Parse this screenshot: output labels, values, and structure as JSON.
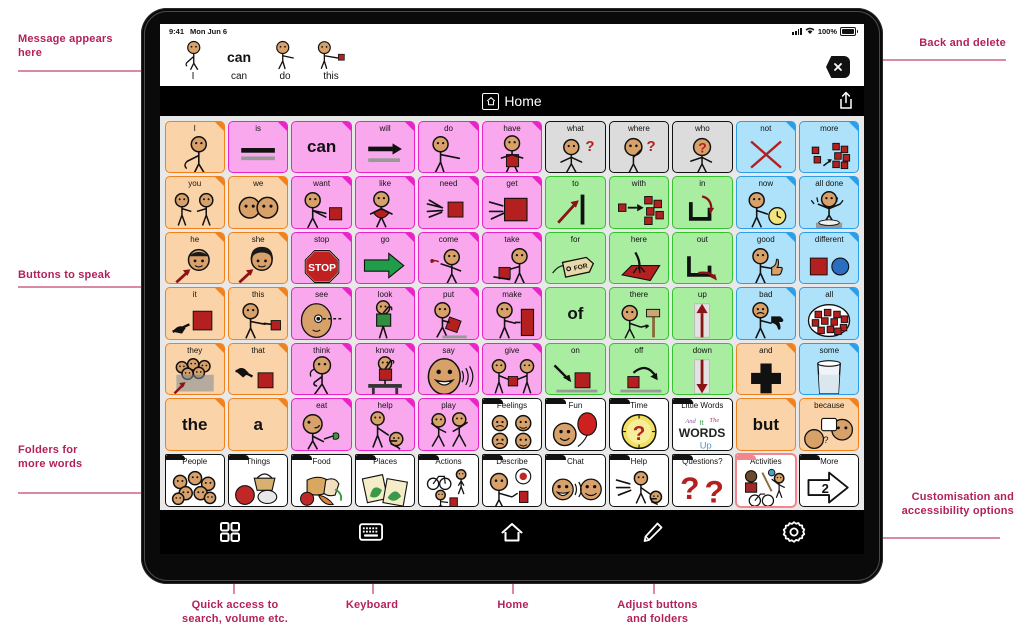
{
  "annotations": {
    "message_appears": "Message appears\nhere",
    "back_delete": "Back and delete",
    "buttons_to_speak": "Buttons to speak",
    "folders_more_words": "Folders for\nmore words",
    "customisation": "Customisation and\naccessibility options",
    "quick_access": "Quick access to\nsearch, volume etc.",
    "keyboard": "Keyboard",
    "home": "Home",
    "adjust": "Adjust buttons\nand folders",
    "color": "#b4215a"
  },
  "status_bar": {
    "time": "9:41",
    "date": "Mon Jun 6",
    "battery": "100%"
  },
  "message_bar": {
    "words": [
      {
        "label": "I",
        "type": "symbol",
        "symbol": "person-pointing-self"
      },
      {
        "label": "can",
        "type": "text",
        "big": "can"
      },
      {
        "label": "do",
        "type": "symbol",
        "symbol": "person-doing"
      },
      {
        "label": "this",
        "type": "symbol",
        "symbol": "person-pointing-block"
      }
    ],
    "clear_button": "clear-x-icon"
  },
  "nav_bar": {
    "title": "Home",
    "home_icon": "home-icon",
    "share_icon": "share-icon"
  },
  "toolbar": {
    "items": [
      {
        "name": "quick-access",
        "icon": "grid-four-squares-icon"
      },
      {
        "name": "keyboard",
        "icon": "keyboard-icon"
      },
      {
        "name": "home",
        "icon": "home-outline-icon"
      },
      {
        "name": "edit",
        "icon": "pencil-icon"
      },
      {
        "name": "settings",
        "icon": "gear-icon"
      }
    ]
  },
  "grid": {
    "columns": 11,
    "rows": [
      [
        {
          "label": "I",
          "cat": "pron",
          "art": "person-pointing-self"
        },
        {
          "label": "is",
          "cat": "verb",
          "art": "equals-bars"
        },
        {
          "label": "",
          "cat": "verb",
          "word": "can"
        },
        {
          "label": "will",
          "cat": "verb",
          "art": "arrow-right-bar"
        },
        {
          "label": "do",
          "cat": "verb",
          "art": "person-doing"
        },
        {
          "label": "have",
          "cat": "verb",
          "art": "person-holding-block"
        },
        {
          "label": "what",
          "cat": "q",
          "art": "person-question"
        },
        {
          "label": "where",
          "cat": "q",
          "art": "head-question"
        },
        {
          "label": "who",
          "cat": "q",
          "art": "question-head"
        },
        {
          "label": "not",
          "cat": "desc",
          "art": "red-x"
        },
        {
          "label": "more",
          "cat": "desc",
          "art": "blocks-more"
        }
      ],
      [
        {
          "label": "you",
          "cat": "pron",
          "art": "two-people-pointing"
        },
        {
          "label": "we",
          "cat": "pron",
          "art": "two-heads"
        },
        {
          "label": "want",
          "cat": "verb",
          "art": "reach-block"
        },
        {
          "label": "like",
          "cat": "verb",
          "art": "hug-heart"
        },
        {
          "label": "need",
          "cat": "verb",
          "art": "hands-block"
        },
        {
          "label": "get",
          "cat": "verb",
          "art": "grab-block"
        },
        {
          "label": "to",
          "cat": "prep",
          "art": "arrow-to-bar"
        },
        {
          "label": "with",
          "cat": "prep",
          "art": "block-joins"
        },
        {
          "label": "in",
          "cat": "prep",
          "art": "arrow-into"
        },
        {
          "label": "now",
          "cat": "desc",
          "art": "person-clock"
        },
        {
          "label": "all done",
          "cat": "desc",
          "art": "person-hands-up"
        }
      ],
      [
        {
          "label": "he",
          "cat": "pron",
          "art": "boy-arrow"
        },
        {
          "label": "she",
          "cat": "pron",
          "art": "girl-arrow"
        },
        {
          "label": "stop",
          "cat": "verb",
          "art": "stop-sign"
        },
        {
          "label": "go",
          "cat": "verb",
          "art": "green-arrow"
        },
        {
          "label": "come",
          "cat": "verb",
          "art": "person-beckon"
        },
        {
          "label": "take",
          "cat": "verb",
          "art": "person-take-block"
        },
        {
          "label": "for",
          "cat": "prep",
          "art": "tag-for"
        },
        {
          "label": "here",
          "cat": "prep",
          "art": "hand-on-mat"
        },
        {
          "label": "out",
          "cat": "prep",
          "art": "arrow-out"
        },
        {
          "label": "good",
          "cat": "desc",
          "art": "thumbs-up-person"
        },
        {
          "label": "different",
          "cat": "desc",
          "art": "square-circle"
        }
      ],
      [
        {
          "label": "it",
          "cat": "pron",
          "art": "hand-point-block"
        },
        {
          "label": "this",
          "cat": "pron",
          "art": "person-point-block"
        },
        {
          "label": "see",
          "cat": "verb",
          "art": "eye-gaze"
        },
        {
          "label": "look",
          "cat": "verb",
          "art": "person-looking"
        },
        {
          "label": "put",
          "cat": "verb",
          "art": "person-put"
        },
        {
          "label": "make",
          "cat": "verb",
          "art": "person-make"
        },
        {
          "label": "",
          "cat": "prep",
          "word": "of"
        },
        {
          "label": "there",
          "cat": "prep",
          "art": "person-signpost"
        },
        {
          "label": "up",
          "cat": "prep",
          "art": "arrow-up"
        },
        {
          "label": "bad",
          "cat": "desc",
          "art": "thumbs-down-person"
        },
        {
          "label": "all",
          "cat": "desc",
          "art": "bowl-blocks"
        }
      ],
      [
        {
          "label": "they",
          "cat": "pron",
          "art": "group-people"
        },
        {
          "label": "that",
          "cat": "pron",
          "art": "hand-point-far"
        },
        {
          "label": "think",
          "cat": "verb",
          "art": "person-thinking"
        },
        {
          "label": "know",
          "cat": "verb",
          "art": "person-desk"
        },
        {
          "label": "say",
          "cat": "verb",
          "art": "talking-face"
        },
        {
          "label": "give",
          "cat": "verb",
          "art": "person-give"
        },
        {
          "label": "on",
          "cat": "prep",
          "art": "arrow-onto"
        },
        {
          "label": "off",
          "cat": "prep",
          "art": "arrow-off"
        },
        {
          "label": "down",
          "cat": "prep",
          "art": "arrow-down"
        },
        {
          "label": "and",
          "cat": "pron",
          "art": "plus-sign"
        },
        {
          "label": "some",
          "cat": "desc",
          "art": "glass-half"
        }
      ],
      [
        {
          "label": "",
          "cat": "pron",
          "word": "the"
        },
        {
          "label": "",
          "cat": "pron",
          "word": "a"
        },
        {
          "label": "eat",
          "cat": "verb",
          "art": "person-eating"
        },
        {
          "label": "help",
          "cat": "verb",
          "art": "person-helping"
        },
        {
          "label": "play",
          "cat": "verb",
          "art": "people-playing"
        },
        {
          "label": "Feelings",
          "cat": "folder",
          "art": "four-faces"
        },
        {
          "label": "Fun",
          "cat": "folder",
          "art": "balloon-face"
        },
        {
          "label": "Time",
          "cat": "folder",
          "art": "clock-question"
        },
        {
          "label": "Little Words",
          "cat": "folder",
          "art": "words-up-logo"
        },
        {
          "label": "",
          "cat": "pron",
          "word": "but"
        },
        {
          "label": "because",
          "cat": "pron",
          "art": "two-faces-speech"
        }
      ],
      [
        {
          "label": "People",
          "cat": "folder",
          "art": "many-faces"
        },
        {
          "label": "Things",
          "cat": "folder",
          "art": "basket-objects"
        },
        {
          "label": "Food",
          "cat": "folder",
          "art": "bread-carrot"
        },
        {
          "label": "Places",
          "cat": "folder",
          "art": "two-maps"
        },
        {
          "label": "Actions",
          "cat": "folder",
          "art": "bike-walk"
        },
        {
          "label": "Describe",
          "cat": "folder",
          "art": "person-describe"
        },
        {
          "label": "Chat",
          "cat": "folder",
          "art": "two-chat-faces"
        },
        {
          "label": "Help",
          "cat": "folder",
          "art": "helping-hands"
        },
        {
          "label": "Questions?",
          "cat": "folder",
          "art": "two-question-marks"
        },
        {
          "label": "Activities",
          "cat": "folder",
          "art": "activity-people",
          "highlight": true
        },
        {
          "label": "More",
          "cat": "folder",
          "art": "arrow-two"
        }
      ]
    ]
  }
}
